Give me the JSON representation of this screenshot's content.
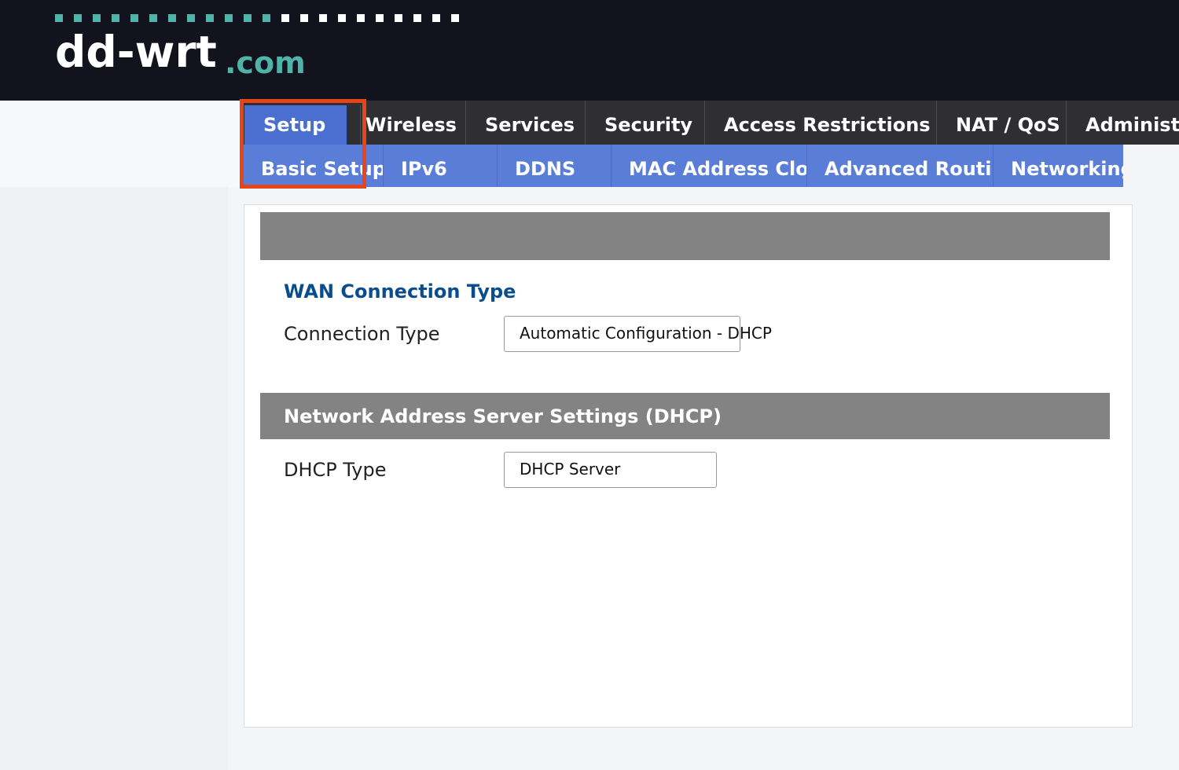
{
  "header": {
    "logo_main": "dd-wrt",
    "logo_tld": ".com",
    "accent_color": "#4fb3a9",
    "dots_accent_count": 12,
    "dots_white_count": 10
  },
  "nav": {
    "main_tabs": [
      {
        "label": "Setup",
        "active": true
      },
      {
        "label": "Wireless",
        "active": false
      },
      {
        "label": "Services",
        "active": false
      },
      {
        "label": "Security",
        "active": false
      },
      {
        "label": "Access Restrictions",
        "active": false
      },
      {
        "label": "NAT / QoS",
        "active": false
      },
      {
        "label": "Administration",
        "active": false
      }
    ],
    "sub_tabs": [
      {
        "label": "Basic Setup",
        "active": true
      },
      {
        "label": "IPv6",
        "active": false
      },
      {
        "label": "DDNS",
        "active": false
      },
      {
        "label": "MAC Address Clone",
        "active": false
      },
      {
        "label": "Advanced Routing",
        "active": false
      },
      {
        "label": "Networking",
        "active": false
      }
    ]
  },
  "content": {
    "wan_section_title": "WAN Connection Type",
    "connection_type_label": "Connection Type",
    "connection_type_value": "Automatic Configuration - DHCP",
    "dhcp_bar_title": "Network Address Server Settings (DHCP)",
    "dhcp_type_label": "DHCP Type",
    "dhcp_type_value": "DHCP Server"
  }
}
